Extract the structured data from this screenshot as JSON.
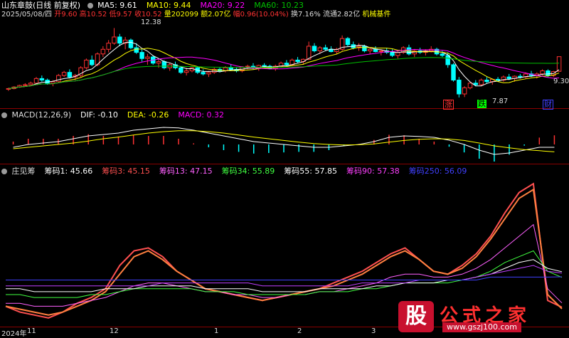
{
  "header_main": {
    "stock_name": "山东章鼓(日线 前复权)",
    "ma5_label": "MA5: 9.61",
    "ma10_label": "MA10: 9.44",
    "ma20_label": "MA20: 9.22",
    "ma60_label": "MA60: 10.23"
  },
  "info_line": {
    "date": "2025/05/08/四",
    "open": "开9.60",
    "high": "高10.52",
    "low": "低9.57",
    "close": "收10.52",
    "volume": "量202099",
    "amount": "额2.07亿",
    "change": "幅0.96(10.04%)",
    "turnover": "换7.16%",
    "float_cap": "流通2.82亿",
    "sector": "机械基件"
  },
  "price_labels": {
    "high_mark": "12.38",
    "low_mark": "7.87",
    "last_mark": "9.30"
  },
  "badges": {
    "zhang": "涨",
    "die": "跌",
    "cai": "财"
  },
  "header_macd": {
    "title": "MACD(12,26,9)",
    "dif": "DIF: -0.10",
    "dea": "DEA: -0.26",
    "macd": "MACD: 0.32"
  },
  "header_zhuang": {
    "title": "庄见筹",
    "c1": "筹码1: 45.66",
    "c3": "筹码3: 45.15",
    "c13": "筹码13: 47.15",
    "c34": "筹码34: 55.89",
    "c55": "筹码55: 57.85",
    "c90": "筹码90: 57.38",
    "c250": "筹码250: 56.09"
  },
  "x_axis": {
    "y2024": "2024年",
    "m11": "11",
    "m12": "12",
    "m1": "1",
    "m2": "2",
    "m3": "3"
  },
  "watermark": {
    "logo_char": "股",
    "title": "公式之家",
    "url": "www.gszj100.com"
  },
  "colors": {
    "up": "#ff3232",
    "down": "#00ffff",
    "ma5": "#ffffff",
    "ma10": "#ffff00",
    "ma20": "#ff00ff",
    "ma60": "#00c000",
    "c1": "#ff5050",
    "c3": "#ff8040",
    "c13": "#ff60ff",
    "c34": "#40ff40",
    "c55": "#ffffff",
    "c90": "#c040ff",
    "c250": "#4040ff"
  },
  "chart_data": [
    {
      "type": "candlestick",
      "title": "山东章鼓(日线 前复权)",
      "ylim": [
        7.5,
        13.0
      ],
      "x": [
        0,
        1,
        2,
        3,
        4,
        5,
        6,
        7,
        8,
        9,
        10,
        11,
        12,
        13,
        14,
        15,
        16,
        17,
        18,
        19,
        20,
        21,
        22,
        23,
        24,
        25,
        26,
        27,
        28,
        29,
        30,
        31,
        32,
        33,
        34,
        35,
        36,
        37,
        38,
        39,
        40,
        41,
        42,
        43,
        44,
        45,
        46,
        47,
        48,
        49,
        50,
        51,
        52,
        53,
        54,
        55,
        56,
        57,
        58,
        59,
        60,
        61,
        62,
        63,
        64,
        65,
        66,
        67,
        68,
        69,
        70,
        71,
        72,
        73,
        74,
        75,
        76,
        77,
        78,
        79,
        80,
        81,
        82,
        83,
        84,
        85,
        86,
        87,
        88,
        89,
        90,
        91,
        92,
        93,
        94,
        95,
        96,
        97,
        98,
        99
      ],
      "ohlc": [
        [
          8.4,
          8.5,
          8.3,
          8.45
        ],
        [
          8.45,
          8.6,
          8.4,
          8.55
        ],
        [
          8.55,
          8.7,
          8.5,
          8.65
        ],
        [
          8.65,
          8.8,
          8.6,
          8.7
        ],
        [
          8.7,
          8.9,
          8.6,
          8.8
        ],
        [
          8.8,
          9.2,
          8.7,
          9.1
        ],
        [
          9.1,
          9.3,
          8.9,
          9.0
        ],
        [
          9.0,
          9.1,
          8.7,
          8.8
        ],
        [
          8.8,
          9.0,
          8.6,
          8.9
        ],
        [
          8.9,
          9.4,
          8.8,
          9.3
        ],
        [
          9.3,
          9.6,
          9.2,
          9.5
        ],
        [
          9.5,
          9.7,
          9.1,
          9.2
        ],
        [
          9.2,
          9.4,
          9.0,
          9.3
        ],
        [
          9.3,
          9.9,
          9.2,
          9.8
        ],
        [
          9.8,
          10.4,
          9.7,
          10.3
        ],
        [
          10.3,
          10.6,
          9.9,
          10.0
        ],
        [
          10.0,
          10.8,
          9.9,
          10.7
        ],
        [
          10.7,
          11.2,
          10.5,
          11.0
        ],
        [
          11.0,
          11.6,
          10.8,
          11.4
        ],
        [
          11.4,
          12.38,
          11.3,
          11.8
        ],
        [
          11.8,
          12.0,
          11.2,
          11.4
        ],
        [
          11.4,
          11.8,
          11.0,
          11.6
        ],
        [
          11.6,
          11.7,
          11.0,
          11.1
        ],
        [
          11.1,
          11.4,
          10.7,
          10.8
        ],
        [
          10.8,
          11.0,
          10.2,
          10.4
        ],
        [
          10.4,
          10.7,
          10.0,
          10.5
        ],
        [
          10.5,
          10.6,
          10.0,
          10.1
        ],
        [
          10.1,
          10.4,
          9.8,
          10.2
        ],
        [
          10.2,
          10.3,
          9.7,
          9.8
        ],
        [
          9.8,
          10.1,
          9.6,
          10.0
        ],
        [
          10.0,
          10.2,
          9.7,
          9.8
        ],
        [
          9.8,
          9.9,
          9.4,
          9.5
        ],
        [
          9.5,
          9.8,
          9.3,
          9.6
        ],
        [
          9.6,
          9.9,
          9.5,
          9.8
        ],
        [
          9.8,
          9.9,
          9.4,
          9.5
        ],
        [
          9.5,
          9.7,
          9.3,
          9.4
        ],
        [
          9.4,
          9.6,
          9.2,
          9.5
        ],
        [
          9.5,
          9.8,
          9.4,
          9.7
        ],
        [
          9.7,
          9.8,
          9.5,
          9.6
        ],
        [
          9.6,
          9.9,
          9.5,
          9.8
        ],
        [
          9.8,
          10.0,
          9.6,
          9.7
        ],
        [
          9.7,
          9.8,
          9.5,
          9.6
        ],
        [
          9.6,
          9.9,
          9.5,
          9.85
        ],
        [
          9.85,
          10.0,
          9.7,
          9.9
        ],
        [
          9.9,
          10.1,
          9.7,
          9.8
        ],
        [
          9.8,
          10.0,
          9.6,
          9.95
        ],
        [
          9.95,
          10.1,
          9.8,
          9.9
        ],
        [
          9.9,
          10.0,
          9.7,
          9.75
        ],
        [
          9.75,
          10.0,
          9.6,
          9.9
        ],
        [
          9.9,
          10.2,
          9.8,
          10.1
        ],
        [
          10.1,
          10.3,
          9.9,
          10.0
        ],
        [
          10.0,
          10.4,
          9.9,
          10.3
        ],
        [
          10.3,
          10.5,
          10.1,
          10.2
        ],
        [
          10.2,
          10.4,
          10.0,
          10.35
        ],
        [
          10.35,
          11.5,
          10.3,
          11.2
        ],
        [
          11.2,
          11.4,
          10.8,
          10.9
        ],
        [
          10.9,
          11.2,
          10.7,
          11.1
        ],
        [
          11.1,
          11.3,
          10.9,
          11.0
        ],
        [
          11.0,
          11.2,
          10.8,
          10.85
        ],
        [
          10.85,
          11.1,
          10.7,
          11.0
        ],
        [
          11.0,
          11.9,
          10.9,
          11.7
        ],
        [
          11.7,
          11.8,
          11.2,
          11.3
        ],
        [
          11.3,
          11.5,
          11.0,
          11.1
        ],
        [
          11.1,
          11.4,
          10.9,
          11.2
        ],
        [
          11.2,
          11.3,
          10.8,
          10.9
        ],
        [
          10.9,
          11.1,
          10.7,
          11.0
        ],
        [
          11.0,
          11.2,
          10.8,
          10.85
        ],
        [
          10.85,
          11.0,
          10.6,
          10.9
        ],
        [
          10.9,
          11.1,
          10.7,
          10.8
        ],
        [
          10.8,
          11.0,
          10.5,
          10.6
        ],
        [
          10.6,
          10.9,
          10.4,
          10.8
        ],
        [
          10.8,
          11.2,
          10.7,
          11.1
        ],
        [
          11.1,
          11.3,
          10.6,
          10.7
        ],
        [
          10.7,
          11.0,
          10.5,
          10.9
        ],
        [
          10.9,
          11.1,
          10.7,
          10.8
        ],
        [
          10.8,
          11.0,
          10.6,
          10.9
        ],
        [
          10.9,
          11.2,
          10.8,
          11.0
        ],
        [
          11.0,
          11.1,
          10.6,
          10.7
        ],
        [
          10.7,
          10.9,
          10.5,
          10.6
        ],
        [
          10.6,
          10.8,
          9.8,
          10.0
        ],
        [
          10.0,
          10.1,
          8.9,
          9.0
        ],
        [
          9.0,
          9.2,
          7.87,
          8.1
        ],
        [
          8.1,
          8.6,
          7.9,
          8.5
        ],
        [
          8.5,
          8.9,
          8.4,
          8.8
        ],
        [
          8.8,
          9.0,
          8.6,
          8.7
        ],
        [
          8.7,
          9.1,
          8.6,
          9.0
        ],
        [
          9.0,
          9.2,
          8.8,
          8.9
        ],
        [
          8.9,
          9.1,
          8.7,
          9.05
        ],
        [
          9.05,
          9.2,
          8.9,
          9.0
        ],
        [
          9.0,
          9.3,
          8.9,
          9.2
        ],
        [
          9.2,
          9.4,
          9.0,
          9.1
        ],
        [
          9.1,
          9.3,
          8.9,
          9.25
        ],
        [
          9.25,
          9.4,
          9.1,
          9.2
        ],
        [
          9.2,
          9.5,
          9.1,
          9.4
        ],
        [
          9.4,
          9.6,
          9.2,
          9.3
        ],
        [
          9.3,
          9.5,
          9.1,
          9.4
        ],
        [
          9.4,
          9.7,
          9.3,
          9.6
        ],
        [
          9.6,
          9.7,
          9.2,
          9.3
        ],
        [
          9.3,
          9.6,
          9.2,
          9.55
        ],
        [
          9.57,
          10.52,
          9.57,
          10.52
        ]
      ]
    },
    {
      "type": "line",
      "title": "MACD(12,26,9)",
      "series": [
        {
          "name": "DIF",
          "values": [
            -0.1,
            0.0,
            0.05,
            0.1,
            0.2,
            0.3,
            0.35,
            0.4,
            0.5,
            0.55,
            0.6,
            0.58,
            0.5,
            0.4,
            0.3,
            0.2,
            0.1,
            0.05,
            0.0,
            -0.05,
            -0.1,
            -0.1,
            -0.05,
            0.0,
            0.1,
            0.25,
            0.3,
            0.28,
            0.25,
            0.15,
            0.0,
            -0.2,
            -0.35,
            -0.3,
            -0.2,
            -0.1,
            -0.1
          ]
        },
        {
          "name": "DEA",
          "values": [
            -0.15,
            -0.1,
            -0.05,
            0.0,
            0.05,
            0.12,
            0.2,
            0.26,
            0.33,
            0.4,
            0.45,
            0.48,
            0.48,
            0.45,
            0.4,
            0.33,
            0.26,
            0.2,
            0.14,
            0.08,
            0.03,
            0.0,
            -0.02,
            -0.01,
            0.02,
            0.08,
            0.14,
            0.18,
            0.2,
            0.19,
            0.14,
            0.05,
            -0.05,
            -0.12,
            -0.18,
            -0.22,
            -0.26
          ]
        }
      ],
      "histogram": [
        0.1,
        0.2,
        0.2,
        0.2,
        0.3,
        0.36,
        0.3,
        0.28,
        0.34,
        0.3,
        0.3,
        0.2,
        0.04,
        -0.1,
        -0.2,
        -0.26,
        -0.32,
        -0.3,
        -0.28,
        -0.26,
        -0.26,
        -0.2,
        -0.06,
        0.02,
        0.16,
        0.34,
        0.32,
        0.2,
        0.1,
        -0.08,
        -0.28,
        -0.5,
        -0.6,
        -0.36,
        -0.04,
        0.24,
        0.32
      ]
    },
    {
      "type": "line",
      "title": "庄见筹",
      "series": [
        {
          "name": "筹码1",
          "values": [
            46,
            44,
            43,
            42,
            44,
            47,
            49,
            52,
            60,
            65,
            66,
            63,
            58,
            55,
            52,
            51,
            50,
            49,
            48,
            49,
            50,
            51,
            52,
            54,
            56,
            58,
            61,
            64,
            66,
            62,
            58,
            57,
            60,
            64,
            70,
            78,
            85,
            88,
            48,
            45.66
          ]
        },
        {
          "name": "筹码3",
          "values": [
            46,
            45,
            44,
            43,
            44,
            46,
            48,
            51,
            57,
            63,
            65,
            62,
            58,
            55,
            52,
            51,
            50,
            49,
            48,
            49,
            50,
            51,
            52,
            53,
            55,
            57,
            60,
            63,
            65,
            62,
            58,
            57,
            59,
            63,
            69,
            76,
            83,
            86,
            50,
            45.15
          ]
        },
        {
          "name": "筹码13",
          "values": [
            47,
            47,
            46,
            46,
            46,
            47,
            48,
            49,
            51,
            53,
            54,
            54,
            53,
            52,
            51,
            51,
            50,
            50,
            49,
            49,
            50,
            50,
            51,
            51,
            52,
            53,
            54,
            56,
            57,
            57,
            56,
            56,
            57,
            59,
            62,
            66,
            70,
            74,
            52,
            47.15
          ]
        },
        {
          "name": "筹码34",
          "values": [
            50,
            50,
            49,
            49,
            49,
            49,
            50,
            50,
            51,
            52,
            52,
            52,
            52,
            52,
            51,
            51,
            51,
            50,
            50,
            50,
            50,
            50,
            51,
            51,
            51,
            52,
            52,
            53,
            54,
            54,
            54,
            54,
            55,
            56,
            58,
            61,
            63,
            65,
            58,
            55.89
          ]
        },
        {
          "name": "筹码55",
          "values": [
            52,
            52,
            51,
            51,
            51,
            51,
            51,
            52,
            52,
            52,
            53,
            53,
            53,
            53,
            52,
            52,
            52,
            52,
            51,
            51,
            51,
            51,
            52,
            52,
            52,
            52,
            53,
            53,
            54,
            54,
            54,
            55,
            55,
            56,
            57,
            59,
            61,
            62,
            59,
            57.85
          ]
        },
        {
          "name": "筹码90",
          "values": [
            53,
            53,
            53,
            53,
            53,
            53,
            53,
            53,
            53,
            53,
            53,
            54,
            54,
            54,
            54,
            54,
            54,
            54,
            53,
            53,
            53,
            53,
            53,
            53,
            53,
            54,
            54,
            54,
            54,
            55,
            55,
            55,
            55,
            56,
            57,
            58,
            59,
            60,
            58,
            57.38
          ]
        },
        {
          "name": "筹码250",
          "values": [
            55,
            55,
            55,
            55,
            55,
            55,
            55,
            55,
            55,
            55,
            55,
            55,
            55,
            55,
            55,
            55,
            55,
            55,
            55,
            55,
            55,
            55,
            55,
            55,
            55,
            55,
            55,
            55,
            55,
            55,
            55,
            55,
            55,
            55,
            56,
            56,
            56,
            56,
            56,
            56.09
          ]
        }
      ]
    }
  ]
}
